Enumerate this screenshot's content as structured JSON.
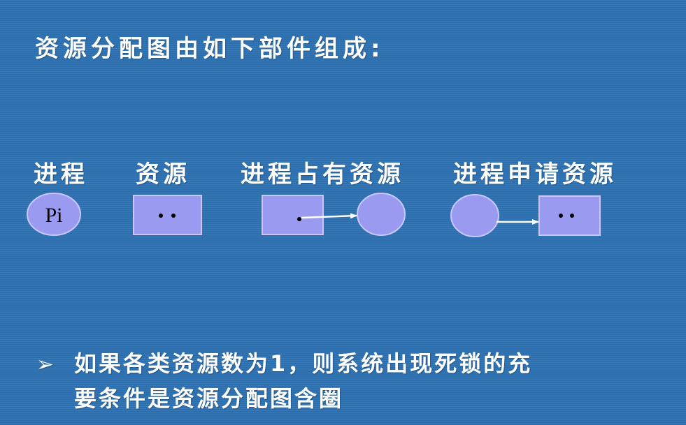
{
  "title": "资源分配图由如下部件组成:",
  "legend": {
    "process": "进程",
    "resource": "资源",
    "holds": "进程占有资源",
    "requests": "进程申请资源"
  },
  "process_node_label": "Pi",
  "bullet": {
    "marker": "➢",
    "line1": "如果各类资源数为1，则系统出现死锁的充",
    "line2": "要条件是资源分配图含圈"
  },
  "colors": {
    "background": "#2f74b6",
    "node_fill": "#9a9af0",
    "node_stroke": "#c8c8ff",
    "edge": "#ffffff",
    "text": "#ffffff"
  }
}
